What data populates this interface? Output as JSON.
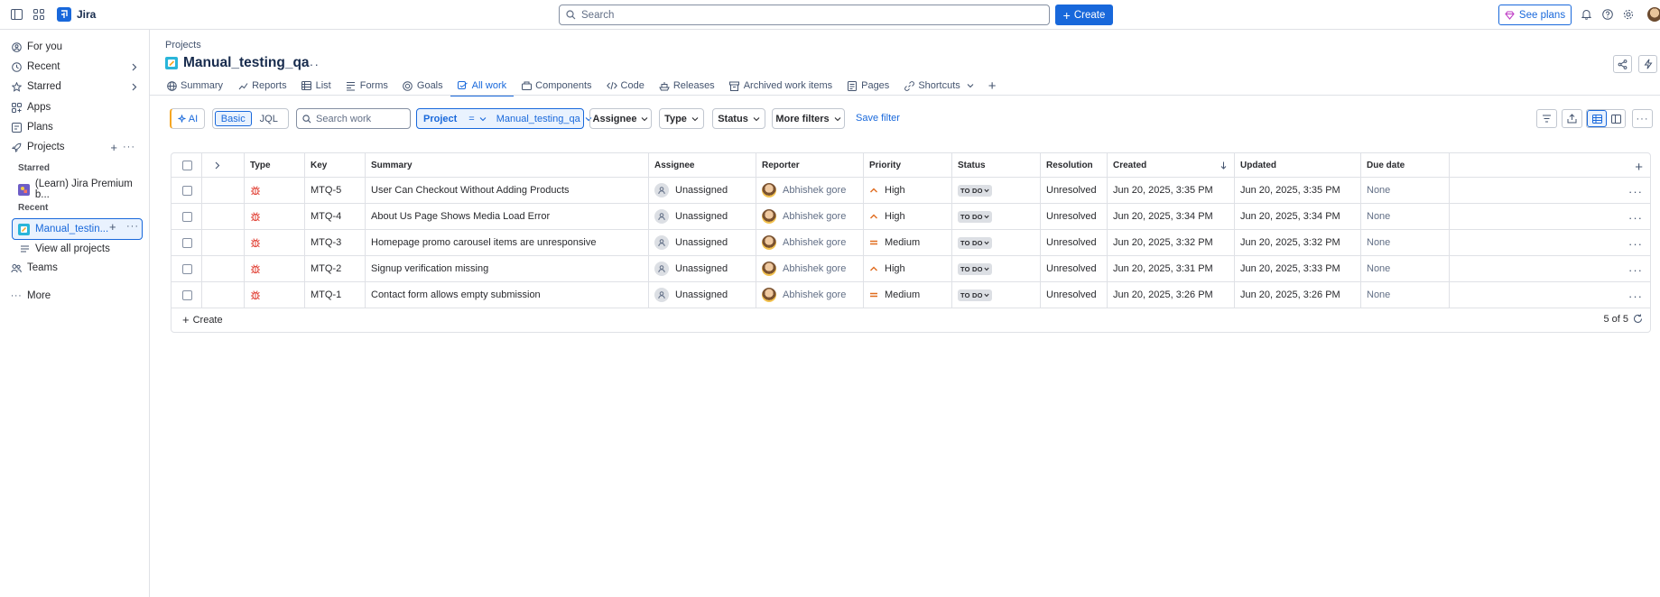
{
  "topbar": {
    "app_name": "Jira",
    "search_placeholder": "Search",
    "create_label": "Create",
    "see_plans_label": "See plans"
  },
  "sidebar": {
    "items": [
      {
        "label": "For you"
      },
      {
        "label": "Recent"
      },
      {
        "label": "Starred"
      },
      {
        "label": "Apps"
      },
      {
        "label": "Plans"
      },
      {
        "label": "Projects"
      }
    ],
    "starred_heading": "Starred",
    "starred_project": "(Learn) Jira Premium b...",
    "recent_heading": "Recent",
    "recent_project": "Manual_testin...",
    "view_all": "View all projects",
    "teams": "Teams",
    "more": "More"
  },
  "header": {
    "breadcrumb": "Projects",
    "title": "Manual_testing_qa"
  },
  "tabs": [
    {
      "label": "Summary",
      "icon": "globe-icon"
    },
    {
      "label": "Reports",
      "icon": "chart-icon"
    },
    {
      "label": "List",
      "icon": "list-icon"
    },
    {
      "label": "Forms",
      "icon": "form-icon"
    },
    {
      "label": "Goals",
      "icon": "target-icon"
    },
    {
      "label": "All work",
      "icon": "all-work-icon",
      "active": true
    },
    {
      "label": "Components",
      "icon": "components-icon"
    },
    {
      "label": "Code",
      "icon": "code-icon"
    },
    {
      "label": "Releases",
      "icon": "ship-icon"
    },
    {
      "label": "Archived work items",
      "icon": "archive-icon"
    },
    {
      "label": "Pages",
      "icon": "page-icon"
    },
    {
      "label": "Shortcuts",
      "icon": "link-icon"
    }
  ],
  "filters": {
    "ai_label": "AI",
    "basic_label": "Basic",
    "jql_label": "JQL",
    "search_placeholder": "Search work",
    "project_label": "Project",
    "project_op": "=",
    "project_value": "Manual_testing_qa",
    "assignee_label": "Assignee",
    "type_label": "Type",
    "status_label": "Status",
    "more_filters_label": "More filters",
    "save_filter_label": "Save filter"
  },
  "table": {
    "columns": [
      "Type",
      "Key",
      "Summary",
      "Assignee",
      "Reporter",
      "Priority",
      "Status",
      "Resolution",
      "Created",
      "Updated",
      "Due date"
    ],
    "rows": [
      {
        "key": "MTQ-5",
        "summary": "User Can Checkout Without Adding Products",
        "assignee": "Unassigned",
        "reporter": "Abhishek gore",
        "priority": "High",
        "status": "TO DO",
        "resolution": "Unresolved",
        "created": "Jun 20, 2025, 3:35 PM",
        "updated": "Jun 20, 2025, 3:35 PM",
        "due": "None"
      },
      {
        "key": "MTQ-4",
        "summary": "About Us Page Shows Media Load Error",
        "assignee": "Unassigned",
        "reporter": "Abhishek gore",
        "priority": "High",
        "status": "TO DO",
        "resolution": "Unresolved",
        "created": "Jun 20, 2025, 3:34 PM",
        "updated": "Jun 20, 2025, 3:34 PM",
        "due": "None"
      },
      {
        "key": "MTQ-3",
        "summary": "Homepage promo carousel items are unresponsive",
        "assignee": "Unassigned",
        "reporter": "Abhishek gore",
        "priority": "Medium",
        "status": "TO DO",
        "resolution": "Unresolved",
        "created": "Jun 20, 2025, 3:32 PM",
        "updated": "Jun 20, 2025, 3:32 PM",
        "due": "None"
      },
      {
        "key": "MTQ-2",
        "summary": "Signup verification missing",
        "assignee": "Unassigned",
        "reporter": "Abhishek gore",
        "priority": "High",
        "status": "TO DO",
        "resolution": "Unresolved",
        "created": "Jun 20, 2025, 3:31 PM",
        "updated": "Jun 20, 2025, 3:33 PM",
        "due": "None"
      },
      {
        "key": "MTQ-1",
        "summary": "Contact form allows empty submission",
        "assignee": "Unassigned",
        "reporter": "Abhishek gore",
        "priority": "Medium",
        "status": "TO DO",
        "resolution": "Unresolved",
        "created": "Jun 20, 2025, 3:26 PM",
        "updated": "Jun 20, 2025, 3:26 PM",
        "due": "None"
      }
    ],
    "footer_create": "Create",
    "count": "5 of 5"
  },
  "colors": {
    "accent": "#1868db",
    "bug": "#e2483d",
    "priority": "#e06c1f"
  }
}
